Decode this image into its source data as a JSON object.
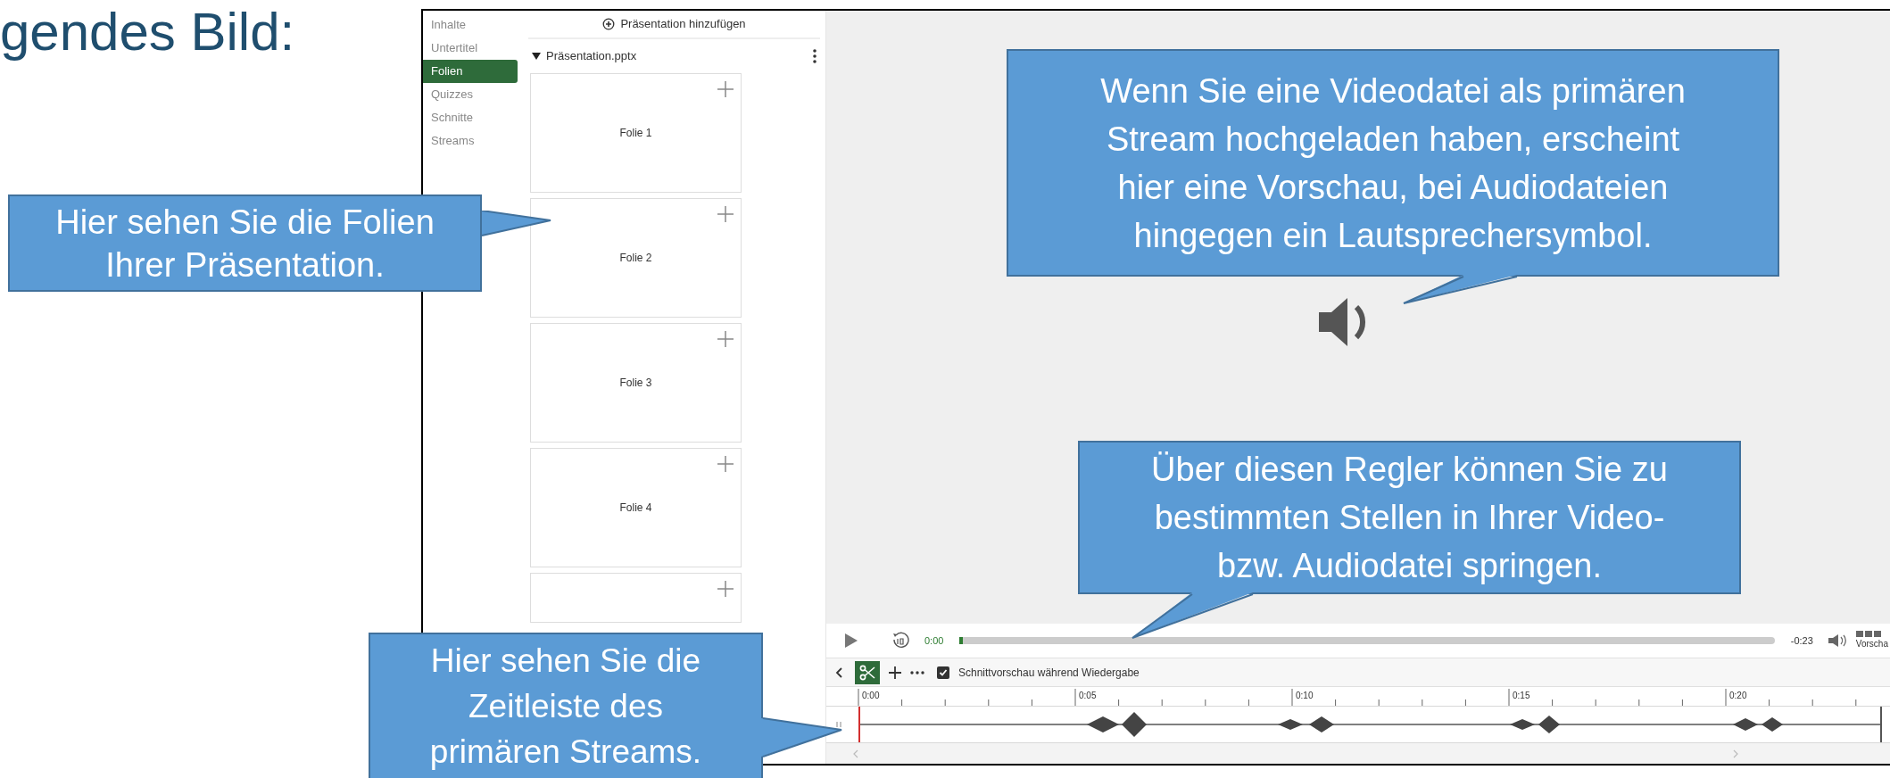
{
  "slide_title": "gendes Bild:",
  "app": {
    "nav": [
      {
        "label": "Inhalte",
        "selected": false
      },
      {
        "label": "Untertitel",
        "selected": false
      },
      {
        "label": "Folien",
        "selected": true
      },
      {
        "label": "Quizzes",
        "selected": false
      },
      {
        "label": "Schnitte",
        "selected": false
      },
      {
        "label": "Streams",
        "selected": false
      }
    ],
    "add_presentation": "Präsentation hinzufügen",
    "file": {
      "name": "Präsentation.pptx",
      "expanded": true
    },
    "slides": [
      {
        "kind": "slide",
        "label": "Folie 1"
      },
      {
        "kind": "slide",
        "label": "Folie 2"
      },
      {
        "kind": "slide",
        "label": "Folie 3"
      },
      {
        "kind": "slide",
        "label": "Folie 4"
      },
      {
        "kind": "covered"
      }
    ],
    "player": {
      "elapsed": "0:00",
      "level": 0.004,
      "remaining": "-0:23",
      "preview_label": "Vorscha"
    },
    "timeline": {
      "cut_preview": {
        "label": "Schnittvorschau während Wiedergabe",
        "checked": true
      },
      "ticks": [
        "0:00",
        "0:05",
        "0:10",
        "0:15",
        "0:20"
      ]
    }
  },
  "callouts": [
    {
      "lines": [
        "Hier sehen Sie die Folien",
        "Ihrer Präsentation."
      ]
    },
    {
      "lines": [
        "Wenn Sie eine Videodatei als primären",
        "Stream hochgeladen haben, erscheint",
        "hier eine Vorschau, bei Audiodateien",
        "hingegen ein Lautsprechersymbol."
      ]
    },
    {
      "lines": [
        "Über diesen Regler können Sie zu",
        "bestimmten Stellen in Ihrer Video-",
        "bzw. Audiodatei springen."
      ]
    },
    {
      "lines": [
        "Hier sehen Sie die",
        "Zeitleiste des",
        "primären Streams."
      ]
    }
  ]
}
